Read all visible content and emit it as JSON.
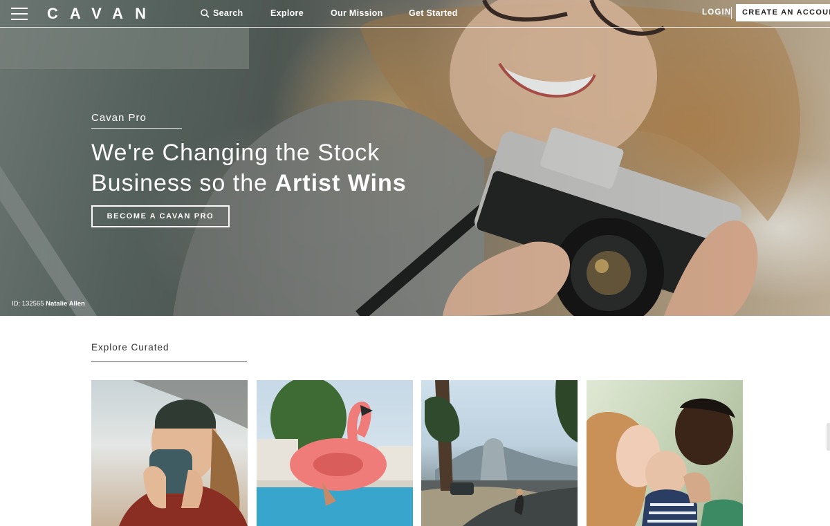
{
  "nav": {
    "logo": "CAVAN",
    "search_label": "Search",
    "links": [
      "Explore",
      "Our Mission",
      "Get Started"
    ],
    "login_label": "LOGIN",
    "create_account_label": "CREATE AN ACCOUNT"
  },
  "hero": {
    "eyebrow": "Cavan Pro",
    "headline_line1": "We're Changing the Stock",
    "headline_line2_regular": "Business so the ",
    "headline_line2_bold": "Artist Wins",
    "cta_label": "BECOME A CAVAN PRO",
    "credit_id": "ID: 132565",
    "credit_author": "Natalie Allen"
  },
  "curated": {
    "title": "Explore Curated",
    "cards": [
      "woman-drinking-coffee",
      "flamingo-pool-float",
      "yosemite-road-skater",
      "family-with-baby"
    ]
  },
  "icons": {
    "menu": "hamburger-icon",
    "search": "search-icon"
  },
  "colors": {
    "nav_text": "#ffffff",
    "create_account_bg": "#ffffff",
    "create_account_text": "#222222",
    "section_text": "#333333"
  }
}
